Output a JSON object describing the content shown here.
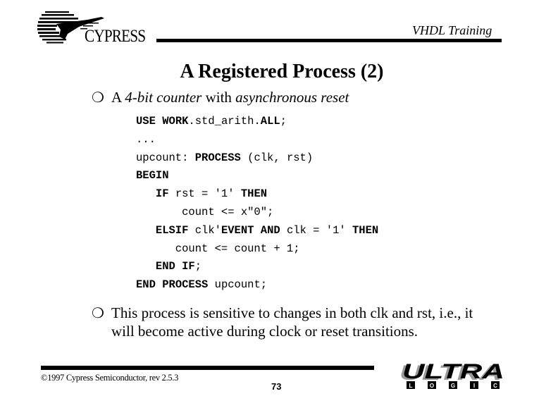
{
  "header": {
    "logo_text": "CYPRESS",
    "course_title": "VHDL Training"
  },
  "slide": {
    "title": "A Registered Process (2)",
    "bullet_icon": "hollow-circle-bullet-icon",
    "bullet1": {
      "parts": [
        {
          "text": "A ",
          "style": "normal"
        },
        {
          "text": "4-bit counter",
          "style": "italic"
        },
        {
          "text": " with ",
          "style": "normal"
        },
        {
          "text": "asynchronous reset",
          "style": "italic"
        }
      ]
    },
    "code_lines": [
      [
        {
          "t": "USE",
          "b": true
        },
        {
          "t": " ",
          "b": false
        },
        {
          "t": "WORK",
          "b": true
        },
        {
          "t": ".std_arith.",
          "b": false
        },
        {
          "t": "ALL",
          "b": true
        },
        {
          "t": ";",
          "b": false
        }
      ],
      [
        {
          "t": "...",
          "b": false
        }
      ],
      [
        {
          "t": "upcount: ",
          "b": false
        },
        {
          "t": "PROCESS",
          "b": true
        },
        {
          "t": " (clk, rst)",
          "b": false
        }
      ],
      [
        {
          "t": "BEGIN",
          "b": true
        }
      ],
      [
        {
          "t": "   ",
          "b": false
        },
        {
          "t": "IF",
          "b": true
        },
        {
          "t": " rst = '1' ",
          "b": false
        },
        {
          "t": "THEN",
          "b": true
        }
      ],
      [
        {
          "t": "       count <= x\"0\";",
          "b": false
        }
      ],
      [
        {
          "t": "   ",
          "b": false
        },
        {
          "t": "ELSIF",
          "b": true
        },
        {
          "t": " clk'",
          "b": false
        },
        {
          "t": "EVENT",
          "b": true
        },
        {
          "t": " ",
          "b": false
        },
        {
          "t": "AND",
          "b": true
        },
        {
          "t": " clk = '1' ",
          "b": false
        },
        {
          "t": "THEN",
          "b": true
        }
      ],
      [
        {
          "t": "      count <= count + 1;",
          "b": false
        }
      ],
      [
        {
          "t": "   ",
          "b": false
        },
        {
          "t": "END",
          "b": true
        },
        {
          "t": " ",
          "b": false
        },
        {
          "t": "IF",
          "b": true
        },
        {
          "t": ";",
          "b": false
        }
      ],
      [
        {
          "t": "END",
          "b": true
        },
        {
          "t": " ",
          "b": false
        },
        {
          "t": "PROCESS",
          "b": true
        },
        {
          "t": " upcount;",
          "b": false
        }
      ]
    ],
    "bullet2": "This process is sensitive to changes in both clk and rst,  i.e., it will become active during clock or reset transitions."
  },
  "footer": {
    "copyright": "©1997 Cypress Semiconductor, rev 2.5.3",
    "page_number": "73",
    "brand_logo": {
      "word": "ULTRA",
      "letters": [
        "L",
        "O",
        "G",
        "I",
        "C"
      ]
    }
  }
}
